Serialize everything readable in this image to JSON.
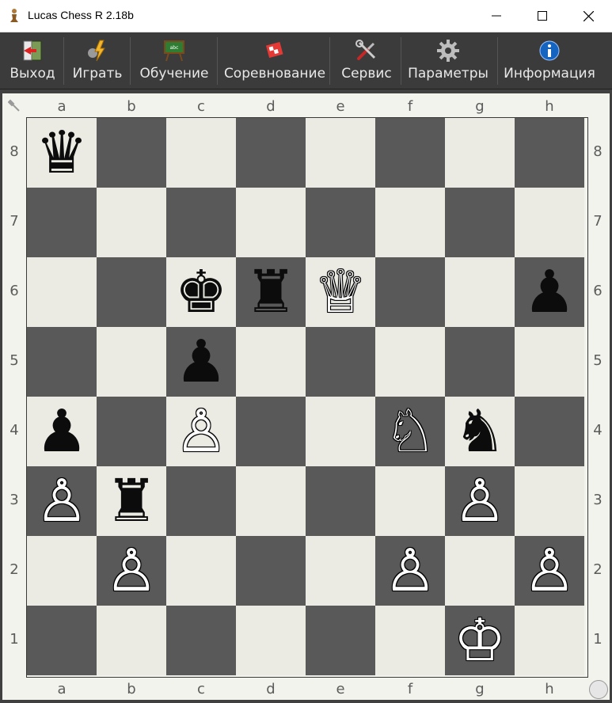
{
  "window": {
    "title": "Lucas Chess R 2.18b"
  },
  "toolbar": {
    "items": [
      {
        "label": "Выход",
        "icon": "exit-door-icon"
      },
      {
        "label": "Играть",
        "icon": "play-lightning-icon"
      },
      {
        "label": "Обучение",
        "icon": "training-board-icon"
      },
      {
        "label": "Соревнование",
        "icon": "competition-flag-icon"
      },
      {
        "label": "Сервис",
        "icon": "tools-icon"
      },
      {
        "label": "Параметры",
        "icon": "gear-icon"
      },
      {
        "label": "Информация",
        "icon": "info-icon"
      }
    ]
  },
  "board": {
    "files": [
      "a",
      "b",
      "c",
      "d",
      "e",
      "f",
      "g",
      "h"
    ],
    "ranks": [
      "8",
      "7",
      "6",
      "5",
      "4",
      "3",
      "2",
      "1"
    ],
    "light_color": "#ebebe4",
    "dark_color": "#595959",
    "pieces": [
      {
        "square": "a8",
        "color": "black",
        "type": "queen"
      },
      {
        "square": "c6",
        "color": "black",
        "type": "king"
      },
      {
        "square": "d6",
        "color": "black",
        "type": "rook"
      },
      {
        "square": "e6",
        "color": "white",
        "type": "queen"
      },
      {
        "square": "h6",
        "color": "black",
        "type": "pawn"
      },
      {
        "square": "c5",
        "color": "black",
        "type": "pawn"
      },
      {
        "square": "a4",
        "color": "black",
        "type": "pawn"
      },
      {
        "square": "c4",
        "color": "white",
        "type": "pawn"
      },
      {
        "square": "f4",
        "color": "white",
        "type": "knight"
      },
      {
        "square": "g4",
        "color": "black",
        "type": "knight"
      },
      {
        "square": "a3",
        "color": "white",
        "type": "pawn"
      },
      {
        "square": "b3",
        "color": "black",
        "type": "rook"
      },
      {
        "square": "g3",
        "color": "white",
        "type": "pawn"
      },
      {
        "square": "b2",
        "color": "white",
        "type": "pawn"
      },
      {
        "square": "f2",
        "color": "white",
        "type": "pawn"
      },
      {
        "square": "h2",
        "color": "white",
        "type": "pawn"
      },
      {
        "square": "g1",
        "color": "white",
        "type": "king"
      }
    ]
  }
}
